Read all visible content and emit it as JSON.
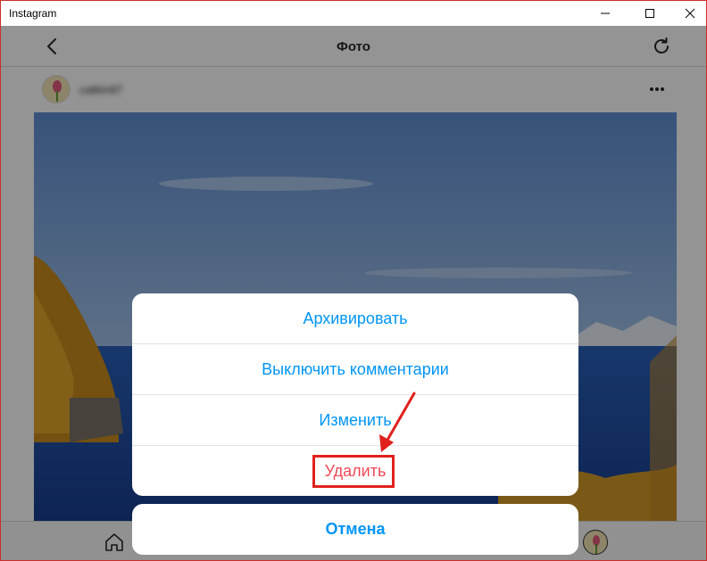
{
  "window": {
    "title": "Instagram"
  },
  "header": {
    "title": "Фото"
  },
  "post": {
    "username": "catkin97"
  },
  "action_sheet": {
    "items": [
      {
        "label": "Архивировать"
      },
      {
        "label": "Выключить комментарии"
      },
      {
        "label": "Изменить"
      },
      {
        "label": "Удалить"
      }
    ],
    "cancel_label": "Отмена"
  },
  "colors": {
    "action_blue": "#0095f6",
    "delete_red": "#ed4956",
    "highlight_red": "#e0211c",
    "window_border": "#c9302c"
  },
  "icons": [
    "back-arrow-icon",
    "refresh-icon",
    "more-icon",
    "home-icon",
    "minimize-icon",
    "maximize-icon",
    "close-icon"
  ]
}
